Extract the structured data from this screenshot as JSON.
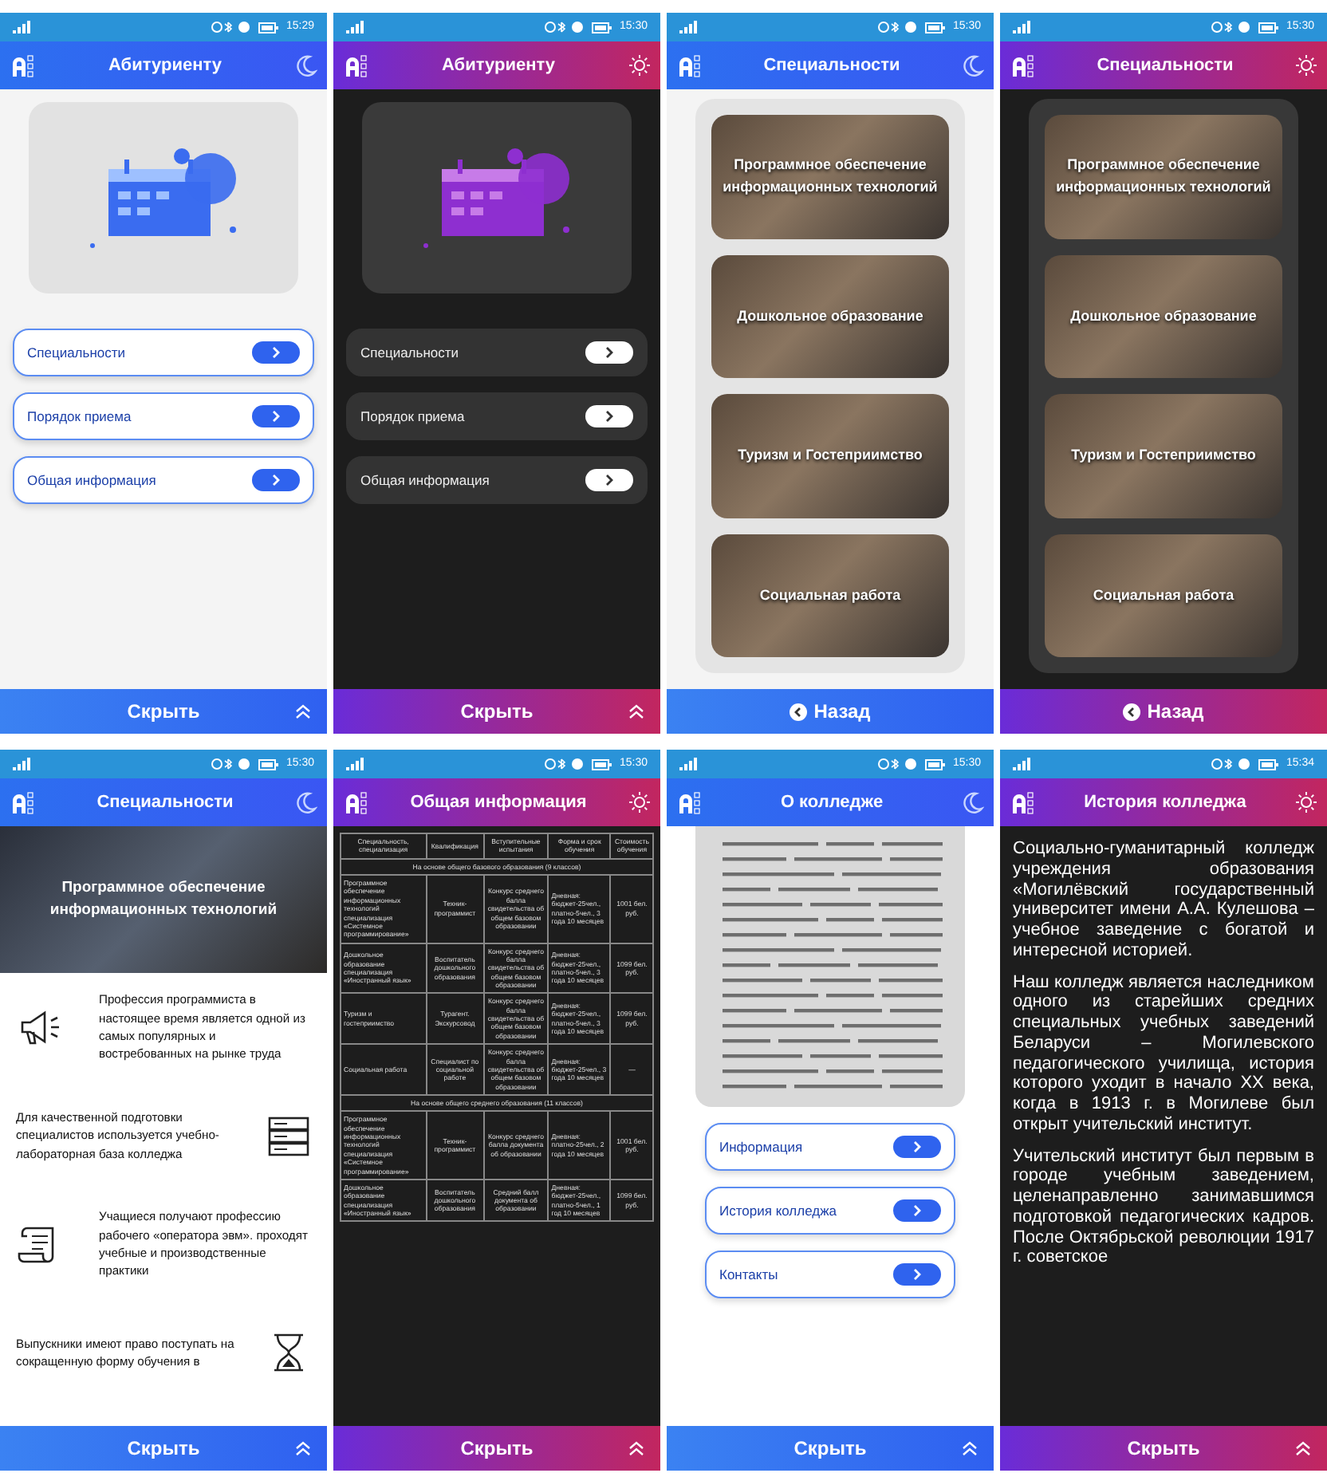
{
  "screens": [
    {
      "kind": "menu",
      "dark_mode": false,
      "time": "15:29",
      "title": "Абитуриенту",
      "items": [
        {
          "label": "Специальности"
        },
        {
          "label": "Порядок приема"
        },
        {
          "label": "Общая информация"
        }
      ],
      "footer": {
        "kind": "hide",
        "label": "Скрыть"
      }
    },
    {
      "kind": "menu",
      "dark_mode": true,
      "time": "15:30",
      "title": "Абитуриенту",
      "items": [
        {
          "label": "Специальности"
        },
        {
          "label": "Порядок приема"
        },
        {
          "label": "Общая информация"
        }
      ],
      "footer": {
        "kind": "hide",
        "label": "Скрыть"
      }
    },
    {
      "kind": "cards",
      "dark_mode": false,
      "time": "15:30",
      "title": "Специальности",
      "cards": [
        {
          "label": "Программное обеспечение информационных технологий"
        },
        {
          "label": "Дошкольное образование"
        },
        {
          "label": "Туризм и Гостеприимство"
        },
        {
          "label": "Социальная работа"
        }
      ],
      "footer": {
        "kind": "back",
        "label": "Назад"
      }
    },
    {
      "kind": "cards",
      "dark_mode": true,
      "time": "15:30",
      "title": "Специальности",
      "cards": [
        {
          "label": "Программное обеспечение информационных технологий"
        },
        {
          "label": "Дошкольное образование"
        },
        {
          "label": "Туризм и Гостеприимство"
        },
        {
          "label": "Социальная работа"
        }
      ],
      "footer": {
        "kind": "back",
        "label": "Назад"
      }
    },
    {
      "kind": "detail",
      "dark_mode": false,
      "time": "15:30",
      "title": "Специальности",
      "banner": "Программное обеспечение информационных технологий",
      "features": [
        "Профессия программиста в настоящее время является одной из самых популярных и востребованных на рынке труда",
        "Для качественной подготовки специалистов используется учебно-лабораторная база колледжа",
        "Учащиеся получают профессию рабочего «оператора эвм». проходят учебные и производственные практики",
        "Выпускники имеют право поступать на сокращенную форму обучения в"
      ],
      "footer": {
        "kind": "hide",
        "label": "Скрыть"
      }
    },
    {
      "kind": "table",
      "dark_mode": true,
      "time": "15:30",
      "title": "Общая информация",
      "table": {
        "columns": [
          "Специальность, специализация",
          "Квалификация",
          "Вступительные испытания",
          "Форма и срок обучения",
          "Стоимость обучения"
        ],
        "rows": [
          {
            "kind": "section",
            "text": "На основе общего базового образования (9 классов)"
          },
          {
            "kind": "data",
            "cells": [
              "Программное обеспечение информационных технологий специализация «Системное программирование»",
              "Техник-программист",
              "Конкурс среднего балла свидетельства об общем базовом образовании",
              "Дневная: бюджет-25чел., платно-5чел., 3 года 10 месяцев",
              "1001 бел. руб."
            ]
          },
          {
            "kind": "data",
            "cells": [
              "Дошкольное образование специализация «Иностранный язык»",
              "Воспитатель дошкольного образования",
              "Конкурс среднего балла свидетельства об общем базовом образовании",
              "Дневная: бюджет-25чел., платно-5чел., 3 года 10 месяцев",
              "1099 бел. руб."
            ]
          },
          {
            "kind": "data",
            "cells": [
              "Туризм и гостеприимство",
              "Турагент. Экскурсовод",
              "Конкурс среднего балла свидетельства об общем базовом образовании",
              "Дневная: бюджет-25чел., платно-5чел., 3 года 10 месяцев",
              "1099 бел. руб."
            ]
          },
          {
            "kind": "data",
            "cells": [
              "Социальная работа",
              "Специалист по социальной работе",
              "Конкурс среднего балла свидетельства об общем базовом образовании",
              "Дневная: бюджет-25чел., 3 года 10 месяцев",
              "—"
            ]
          },
          {
            "kind": "section",
            "text": "На основе общего среднего образования (11 классов)"
          },
          {
            "kind": "data",
            "cells": [
              "Программное обеспечение информационных технологий специализация «Системное программирование»",
              "Техник-программист",
              "Конкурс среднего балла документа об образовании",
              "Дневная: платно-25чел., 2 года 10 месяцев",
              "1001 бел. руб."
            ]
          },
          {
            "kind": "data",
            "cells": [
              "Дошкольное образование специализация «Иностранный язык»",
              "Воспитатель дошкольного образования",
              "Средний балл документа об образовании",
              "Дневная: бюджет-25чел., платно-5чел., 1 год 10 месяцев",
              "1099 бел. руб."
            ]
          }
        ]
      },
      "footer": {
        "kind": "hide",
        "label": "Скрыть"
      }
    },
    {
      "kind": "about",
      "dark_mode": false,
      "time": "15:30",
      "title": "О колледже",
      "items": [
        {
          "label": "Информация"
        },
        {
          "label": "История колледжа"
        },
        {
          "label": "Контакты"
        }
      ],
      "footer": {
        "kind": "hide",
        "label": "Скрыть"
      }
    },
    {
      "kind": "text",
      "dark_mode": true,
      "time": "15:34",
      "title": "История колледжа",
      "paragraphs": [
        "Социально-гуманитарный колледж учреждения образования «Могилёвский государственный университет имени А.А. Кулешова – учебное заведение с богатой и интересной историей.",
        "Наш колледж является наследником одного из старейших средних специальных учебных заведений Беларуси – Могилевского педагогического училища, история которого уходит в начало XX века, когда в 1913 г. в Могилеве был открыт учительский институт.",
        "Учительский институт был первым в городе учебным заведением, целенаправленно занимавшимся подготовкой педагогических кадров. После Октябрьской революции 1917 г. советское"
      ],
      "footer": {
        "kind": "hide",
        "label": "Скрыть"
      }
    }
  ]
}
